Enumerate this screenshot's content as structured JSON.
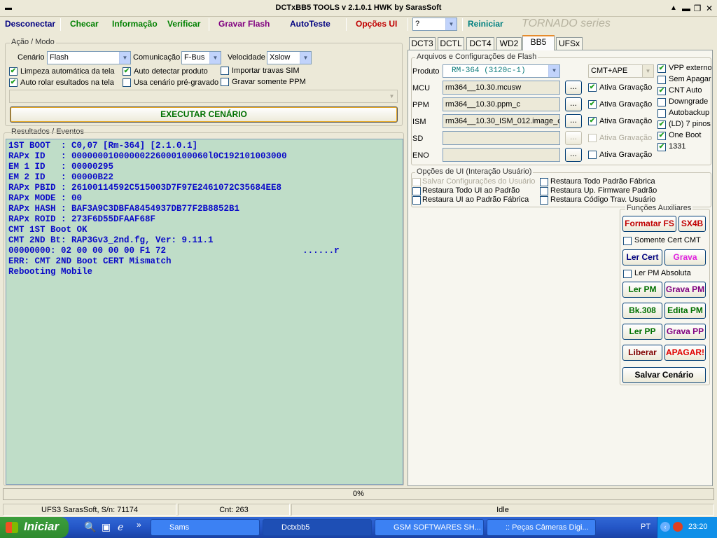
{
  "window": {
    "title": "DCTxBB5 TOOLS v 2.1.0.1 HWK by SarasSoft",
    "minimize": "▲",
    "min2": "▬",
    "max": "❐",
    "close": "✕"
  },
  "menu": [
    {
      "label": "Desconectar",
      "color": "#000080"
    },
    {
      "label": "Checar",
      "color": "#008000"
    },
    {
      "label": "Informação",
      "color": "#008000"
    },
    {
      "label": "Verificar",
      "color": "#008000"
    },
    {
      "label": "Gravar Flash",
      "color": "#800080"
    },
    {
      "label": "AutoTeste",
      "color": "#000080"
    },
    {
      "label": "Opções UI",
      "color": "#c00000"
    },
    {
      "label": "Reiniciar",
      "color": "#008080"
    }
  ],
  "menu_combo": "?",
  "tornado": "TORNADO series",
  "acao": {
    "title": "Ação / Modo",
    "cenario_label": "Cenário",
    "cenario": "Flash",
    "comunicacao_label": "Comunicação",
    "comunicacao": "F-Bus",
    "velocidade_label": "Velocidade",
    "velocidade": "Xslow",
    "checks": [
      {
        "label": "Limpeza automática da tela",
        "checked": true
      },
      {
        "label": "Auto detectar produto",
        "checked": true
      },
      {
        "label": "Importar travas SIM",
        "checked": false
      },
      {
        "label": "Auto rolar esultados na tela",
        "checked": true
      },
      {
        "label": "Usa cenário pré-gravado",
        "checked": false
      },
      {
        "label": "Gravar somente PPM",
        "checked": false
      }
    ],
    "executar": "EXECUTAR CENÁRIO"
  },
  "resultados": {
    "title": "Resultados / Eventos",
    "lines": [
      "1ST BOOT  : C0,07 [Rm-364] [2.1.0.1]",
      "RAPx ID   : 00000001000000226000100060l0C192101003000",
      "EM 1 ID   : 00000295",
      "EM 2 ID   : 00000B22",
      "RAPx PBID : 26100114592C515003D7F97E2461072C35684EE8",
      "RAPx MODE : 00",
      "RAPx HASH : BAF3A9C3DBFA8454937DB77F2B8852B1",
      "RAPx ROID : 273F6D55DFAAF68F",
      "CMT 1ST Boot OK",
      "CMT 2ND Bt: RAP3Gv3_2nd.fg, Ver: 9.11.1",
      "00000000: 02 00 00 00 00 F1 72                          ......r",
      "ERR: CMT 2ND Boot CERT Mismatch",
      "Rebooting Mobile"
    ]
  },
  "tabs": [
    "DCT3",
    "DCTL",
    "DCT4",
    "WD2",
    "BB5",
    "UFSx"
  ],
  "active_tab": "BB5",
  "arquivos": {
    "title": "Arquivos e Configurações de Flash",
    "produto_label": "Produto",
    "produto": "RM-364  (3120c-1)",
    "mode": "CMT+APE",
    "rows": [
      {
        "label": "MCU",
        "value": "rm364__10.30.mcusw",
        "ativa": true,
        "enabled": true
      },
      {
        "label": "PPM",
        "value": "rm364__10.30.ppm_c",
        "ativa": true,
        "enabled": true
      },
      {
        "label": "ISM",
        "value": "rm364__10.30_ISM_012.image_c",
        "ativa": true,
        "enabled": true
      },
      {
        "label": "SD",
        "value": "",
        "ativa": false,
        "enabled": false
      },
      {
        "label": "ENO",
        "value": "",
        "ativa": false,
        "enabled": true
      }
    ],
    "ativa_label": "Ativa Gravação",
    "browse": "...",
    "options": [
      {
        "label": "VPP externo",
        "checked": true
      },
      {
        "label": "Sem Apagar",
        "checked": false
      },
      {
        "label": "CNT Auto",
        "checked": true
      },
      {
        "label": "Downgrade",
        "checked": false
      },
      {
        "label": "Autobackup",
        "checked": false
      },
      {
        "label": "(LD) 7 pinos",
        "checked": true
      },
      {
        "label": "One Boot",
        "checked": true
      },
      {
        "label": "1331",
        "checked": true
      }
    ]
  },
  "opcoes": {
    "title": "Opções de UI (Interação Usuário)",
    "items": [
      {
        "label": "Salvar Configurações do Usuário",
        "enabled": false
      },
      {
        "label": "Restaura Todo Padrão Fábrica",
        "enabled": true
      },
      {
        "label": "Restaura Todo UI ao Padrão",
        "enabled": true
      },
      {
        "label": "Restaura Up. Firmware Padrão",
        "enabled": true
      },
      {
        "label": "Restaura UI ao Padrão Fábrica",
        "enabled": true
      },
      {
        "label": "Restaura Código Trav. Usuário",
        "enabled": true
      }
    ]
  },
  "funcoes": {
    "title": "Funções Auxiliares",
    "formatar": "Formatar FS",
    "sx4b": "SX4B",
    "somente": "Somente Cert CMT",
    "ler_cert": "Ler Cert",
    "grava_cert": "Grava Cert",
    "ler_pm_abs": "Ler PM Absoluta",
    "ler_pm": "Ler PM",
    "grava_pm": "Grava PM",
    "bk308": "Bk.308",
    "edita_pm": "Edita PM",
    "ler_pp": "Ler PP",
    "grava_pp": "Grava PP",
    "liberar": "Liberar",
    "apagar": "APAGAR!",
    "salvar": "Salvar Cenário"
  },
  "progress": {
    "text": "0%",
    "value": 0
  },
  "status": {
    "serial": "UFS3 SarasSoft, S/n: 71174",
    "cnt": "Cnt: 263",
    "state": "Idle"
  },
  "taskbar": {
    "start": "Iniciar",
    "tasks": [
      "Sams",
      "Dctxbb5",
      "GSM SOFTWARES SH...",
      ":: Peças Câmeras Digi..."
    ],
    "lang": "PT",
    "time": "23:20"
  }
}
